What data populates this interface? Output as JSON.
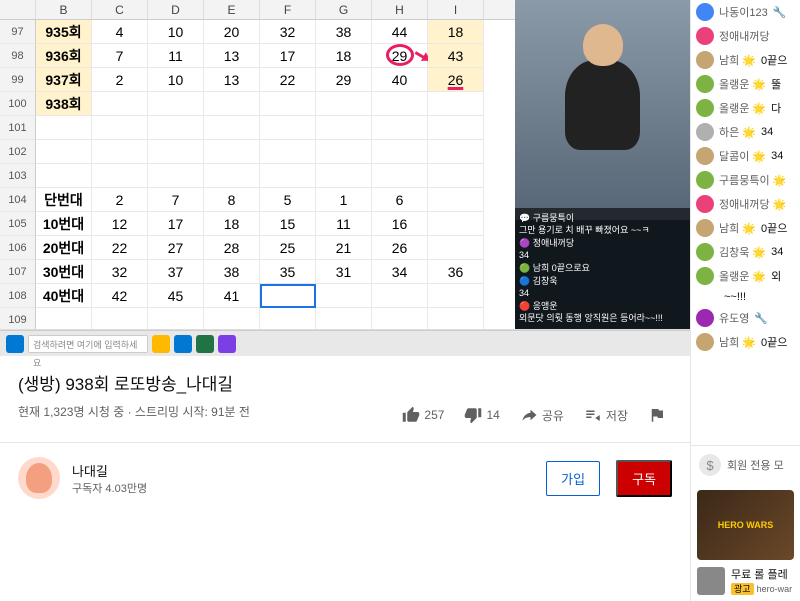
{
  "spreadsheet": {
    "columns": [
      "",
      "B",
      "C",
      "D",
      "E",
      "F",
      "G",
      "H",
      "I"
    ],
    "rows": [
      {
        "num": "97",
        "label": "935회",
        "cells": [
          "4",
          "10",
          "20",
          "32",
          "38",
          "44",
          "18"
        ]
      },
      {
        "num": "98",
        "label": "936회",
        "cells": [
          "7",
          "11",
          "13",
          "17",
          "18",
          "29",
          "43"
        ]
      },
      {
        "num": "99",
        "label": "937회",
        "cells": [
          "2",
          "10",
          "13",
          "22",
          "29",
          "40",
          "26"
        ]
      },
      {
        "num": "100",
        "label": "938회",
        "cells": [
          "",
          "",
          "",
          "",
          "",
          "",
          ""
        ]
      },
      {
        "num": "101",
        "label": "",
        "cells": [
          "",
          "",
          "",
          "",
          "",
          "",
          ""
        ]
      },
      {
        "num": "102",
        "label": "",
        "cells": [
          "",
          "",
          "",
          "",
          "",
          "",
          ""
        ]
      },
      {
        "num": "103",
        "label": "",
        "cells": [
          "",
          "",
          "",
          "",
          "",
          "",
          ""
        ]
      },
      {
        "num": "104",
        "label": "단번대",
        "cells": [
          "2",
          "7",
          "8",
          "5",
          "1",
          "6",
          ""
        ]
      },
      {
        "num": "105",
        "label": "10번대",
        "cells": [
          "12",
          "17",
          "18",
          "15",
          "11",
          "16",
          ""
        ]
      },
      {
        "num": "106",
        "label": "20번대",
        "cells": [
          "22",
          "27",
          "28",
          "25",
          "21",
          "26",
          ""
        ]
      },
      {
        "num": "107",
        "label": "30번대",
        "cells": [
          "32",
          "37",
          "38",
          "35",
          "31",
          "34",
          "36"
        ]
      },
      {
        "num": "108",
        "label": "40번대",
        "cells": [
          "42",
          "45",
          "41",
          "",
          "",
          "",
          ""
        ]
      },
      {
        "num": "109",
        "label": "",
        "cells": [
          "",
          "",
          "",
          "",
          "",
          "",
          ""
        ]
      }
    ]
  },
  "taskbar": {
    "search_placeholder": "검색하려면 여기에 입력하세요"
  },
  "cam_chat": [
    "💬 구름뭉특이",
    "그만 용기로 치 배꾸 빠졌어요 ~~ㅋ",
    "🟣 정애내꺼당",
    "34",
    "🟢 남희 0끝으로요",
    "🔵 김창욱",
    "34",
    "🔴 응앵운",
    "외문닷 의뤗 동행 앙직원은 등어라~~!!!"
  ],
  "video": {
    "title": "(생방) 938회 로또방송_나대길",
    "meta": "현재 1,323명 시청 중 · 스트리밍 시작: 91분 전",
    "likes": "257",
    "dislikes": "14",
    "share": "공유",
    "save": "저장"
  },
  "channel": {
    "name": "나대길",
    "subs": "구독자 4.03만명",
    "join": "가입",
    "subscribe": "구독"
  },
  "chat": [
    {
      "color": "#4285f4",
      "name": "나동이123",
      "msg": "🔧"
    },
    {
      "color": "#ec407a",
      "name": "정애내꺼당",
      "msg": ""
    },
    {
      "color": "#c5a572",
      "name": "남희 🌟",
      "msg": "0끝으"
    },
    {
      "color": "#7cb342",
      "name": "올랭운 🌟",
      "msg": "뚤"
    },
    {
      "color": "#7cb342",
      "name": "올랭운 🌟",
      "msg": "다"
    },
    {
      "color": "#b0b0b0",
      "name": "하은 🌟",
      "msg": "34"
    },
    {
      "color": "#c5a572",
      "name": "달콤이 🌟",
      "msg": "34"
    },
    {
      "color": "#7cb342",
      "name": "구름뭉특이 🌟",
      "msg": ""
    },
    {
      "color": "#ec407a",
      "name": "정애내꺼당 🌟",
      "msg": ""
    },
    {
      "color": "#c5a572",
      "name": "남희 🌟",
      "msg": "0끝으"
    },
    {
      "color": "#7cb342",
      "name": "김창욱 🌟",
      "msg": "34"
    },
    {
      "color": "#7cb342",
      "name": "올랭운 🌟",
      "msg": "외"
    },
    {
      "color": "",
      "name": "",
      "msg": "~~!!!"
    },
    {
      "color": "#9c27b0",
      "name": "유도영",
      "msg": "🔧"
    },
    {
      "color": "#c5a572",
      "name": "남희 🌟",
      "msg": "0끝으"
    }
  ],
  "members": "회원 전용 모",
  "ad": {
    "logo": "HERO WARS",
    "title": "무료 롤 플레",
    "badge": "광고",
    "sub": "hero-war"
  }
}
